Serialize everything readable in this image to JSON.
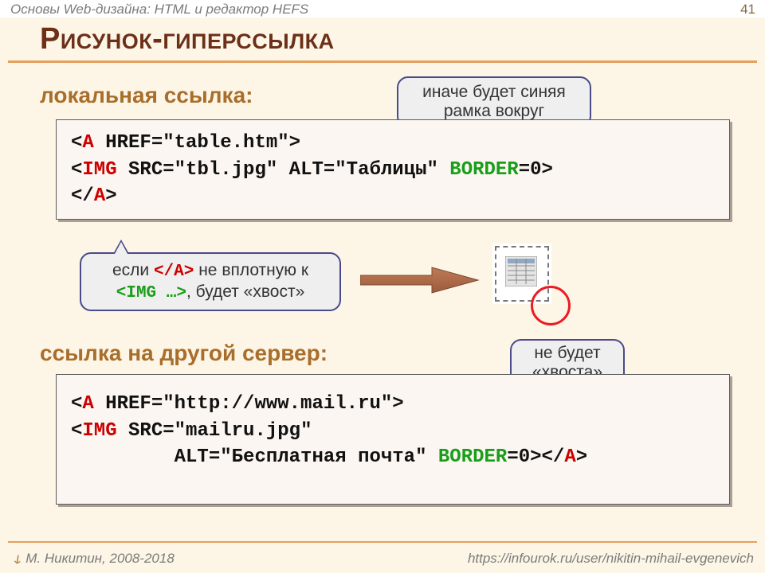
{
  "doc_title": "Основы Web-дизайна: HTML и редактор HEFS",
  "page_number": "41",
  "title": "Рисунок-гиперссылка",
  "section1": "локальная ссылка:",
  "section2": "ссылка на другой сервер:",
  "callouts": {
    "blue_frame": "иначе будет синяя рамка вокруг",
    "tail_before": "если ",
    "tail_tag": "</A>",
    "tail_mid": " не вплотную к ",
    "tail_img": "<IMG …>",
    "tail_after": ", будет «хвост»",
    "no_tail": "не будет «хвоста»"
  },
  "code1": {
    "line1": {
      "open": "<",
      "tag": "A",
      "attrs": " HREF=\"table.htm\"",
      "close": ">"
    },
    "line2": {
      "open": "<",
      "tag": "IMG",
      "attrs": " SRC=\"tbl.jpg\" ALT=\"Таблицы\"",
      "border_key": " BORDER",
      "border_val": "=0",
      "close": ">"
    },
    "line3": {
      "open": "</",
      "tag": "A",
      "close": ">"
    }
  },
  "code2": {
    "line1": {
      "open": "<",
      "tag": "A",
      "attrs": " HREF=\"http://www.mail.ru\"",
      "close": ">"
    },
    "line2": {
      "open": "<",
      "tag": "IMG",
      "attrs": " SRC=\"mailru.jpg\""
    },
    "line3_attrs": "ALT=\"Бесплатная почта\"",
    "line3_border_key": " BORDER",
    "line3_border_val": "=0",
    "line3_close": ">",
    "line3_aopen": "</",
    "line3_atag": "A",
    "line3_aclose": ">"
  },
  "footer": {
    "author": "М. Никитин, 2008-2018",
    "url": "https://infourok.ru/user/nikitin-mihail-evgenevich"
  }
}
